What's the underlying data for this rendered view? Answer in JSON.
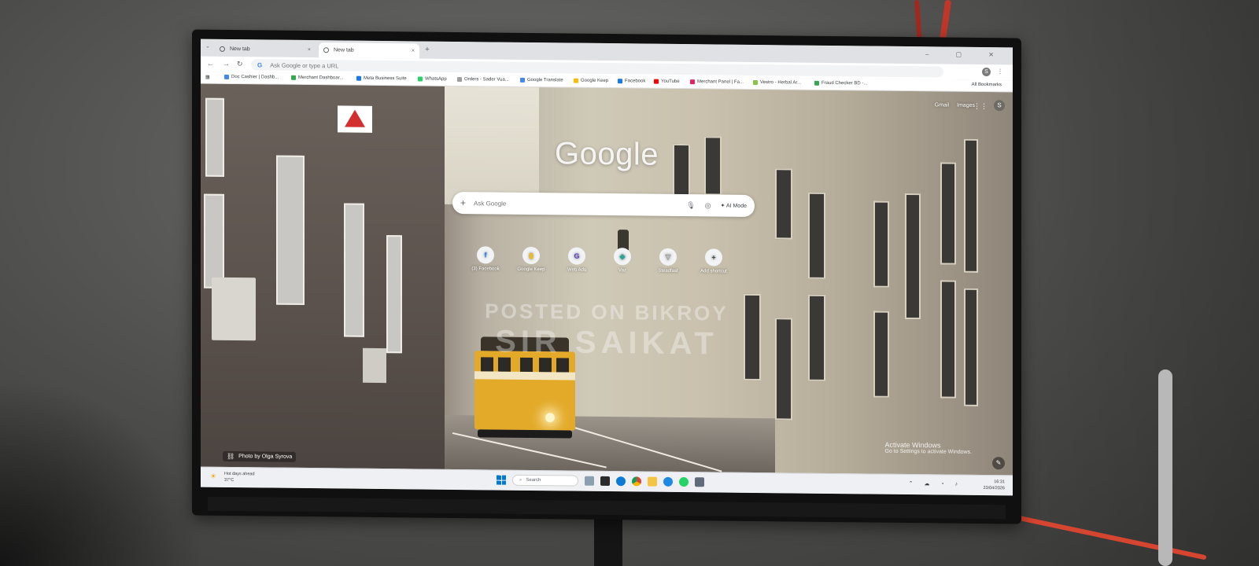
{
  "browser": {
    "tabs": [
      {
        "label": "New tab",
        "active": false
      },
      {
        "label": "New tab",
        "active": true
      }
    ],
    "new_tab_glyph": "+",
    "tab_close_glyph": "×",
    "window_controls": "– ▢ ✕",
    "omnibox": {
      "placeholder": "Ask Google or type a URL"
    },
    "profile_letter": "S",
    "bookmarks": [
      {
        "label": "Doc Cashier | Dashb...",
        "color": "#4285f4"
      },
      {
        "label": "Merchant Dashboar...",
        "color": "#34a853"
      },
      {
        "label": "Meta Business Suite",
        "color": "#1877f2"
      },
      {
        "label": "WhatsApp",
        "color": "#25d366"
      },
      {
        "label": "Orders - Sader Vua...",
        "color": "#9e9e9e"
      },
      {
        "label": "Google Translate",
        "color": "#4285f4"
      },
      {
        "label": "Google Keep",
        "color": "#fbbc04"
      },
      {
        "label": "Facebook",
        "color": "#1877f2"
      },
      {
        "label": "YouTube",
        "color": "#ff0000"
      },
      {
        "label": "Merchant Panel | Fa...",
        "color": "#e91e63"
      },
      {
        "label": "Vestro - Herbal Ar...",
        "color": "#8bc34a"
      },
      {
        "label": "Fraud Checker BD -...",
        "color": "#34a853"
      }
    ],
    "all_bookmarks": "All Bookmarks"
  },
  "ntp": {
    "top_links": [
      "Gmail",
      "Images"
    ],
    "avatar_letter": "S",
    "logo": "Google",
    "search_placeholder": "Ask Google",
    "ai_mode": "AI Mode",
    "shortcuts": [
      {
        "label": "(3) Facebook",
        "glyph": "f",
        "color": "#1877f2"
      },
      {
        "label": "Google Keep",
        "glyph": "▮",
        "color": "#fbbc04"
      },
      {
        "label": "Web Ads",
        "glyph": "G",
        "color": "#5b3cc4"
      },
      {
        "label": "Vaz",
        "glyph": "◆",
        "color": "#26a69a"
      },
      {
        "label": "Steadfast",
        "glyph": "▽",
        "color": "#9e9e9e"
      },
      {
        "label": "Add shortcut",
        "glyph": "+",
        "color": "#3c4043"
      }
    ],
    "photo_credit": "Photo by Olga Syrova",
    "activate_title": "Activate Windows",
    "activate_sub": "Go to Settings to activate Windows."
  },
  "watermark": {
    "line1": "POSTED ON BIKROY",
    "line2": "SIR SAIKAT"
  },
  "taskbar": {
    "weather_line1": "Hot days ahead",
    "weather_line2": "37°C",
    "search_placeholder": "Search",
    "clock_time": "16:31",
    "clock_date": "23/04/2026"
  }
}
